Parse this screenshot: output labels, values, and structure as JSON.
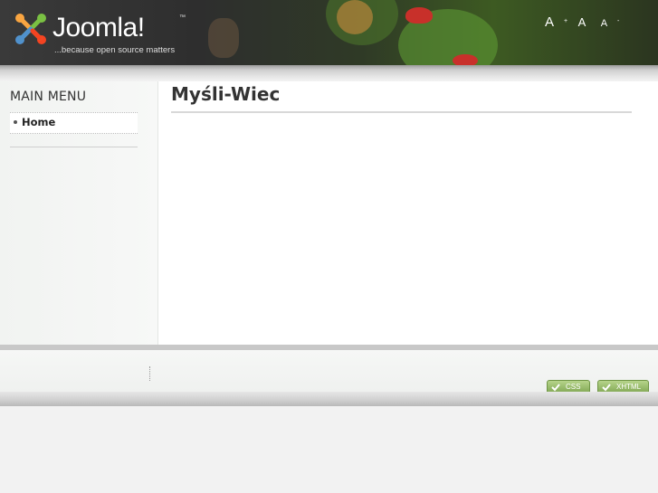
{
  "header": {
    "logo_word": "Joomla!",
    "logo_tm": "™",
    "tagline": "...because open source matters",
    "fontsize": {
      "increase": "A",
      "increase_sup": "+",
      "reset": "A",
      "decrease": "A",
      "decrease_sup": "-"
    }
  },
  "sidebar": {
    "menu_title": "MAIN MENU",
    "items": [
      {
        "label": "Home"
      }
    ]
  },
  "content": {
    "title": "Myśli-Wiec"
  },
  "footer": {
    "badges": [
      {
        "label": "CSS"
      },
      {
        "label": "XHTML"
      }
    ]
  },
  "colors": {
    "badge_green": "#7fa552",
    "header_dark": "#2e2e2e"
  }
}
